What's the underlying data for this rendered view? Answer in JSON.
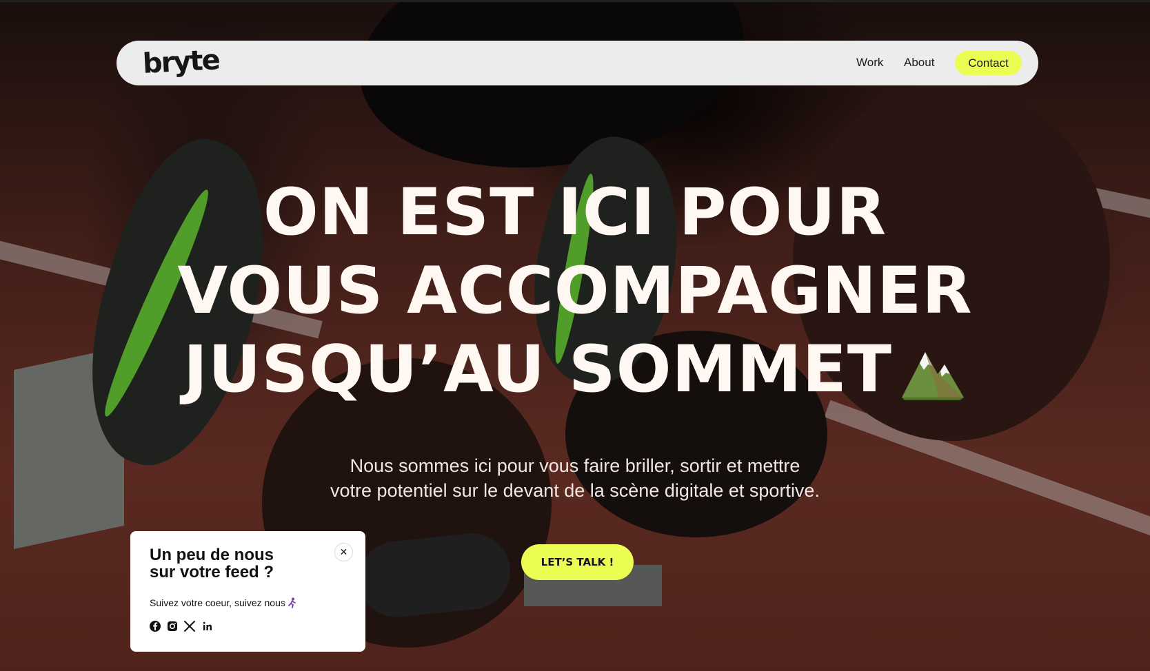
{
  "nav": {
    "logo": "bryte",
    "links": [
      "Work",
      "About"
    ],
    "contact_label": "Contact"
  },
  "hero": {
    "headline_lines": [
      "ON EST ICI POUR",
      "VOUS ACCOMPAGNER",
      "JUSQU’AU SOMMET"
    ],
    "headline_icon": "mountain-icon",
    "subtitle_lines": [
      "Nous sommes ici pour vous faire briller, sortir et mettre",
      "votre potentiel sur le devant de la scène digitale et sportive."
    ],
    "cta_label": "LET’S TALK !"
  },
  "popup": {
    "title_lines": [
      "Un peu de nous",
      "sur votre feed ?"
    ],
    "text": "Suivez votre coeur, suivez nous",
    "text_icon": "runner-icon",
    "close_icon": "close-icon",
    "social_icons": [
      "facebook-icon",
      "instagram-icon",
      "x-icon",
      "linkedin-icon"
    ]
  },
  "colors": {
    "accent": "#ebfc52",
    "navbar_bg": "#ececec",
    "headline": "#fff7f1",
    "track": "#7a3328"
  }
}
